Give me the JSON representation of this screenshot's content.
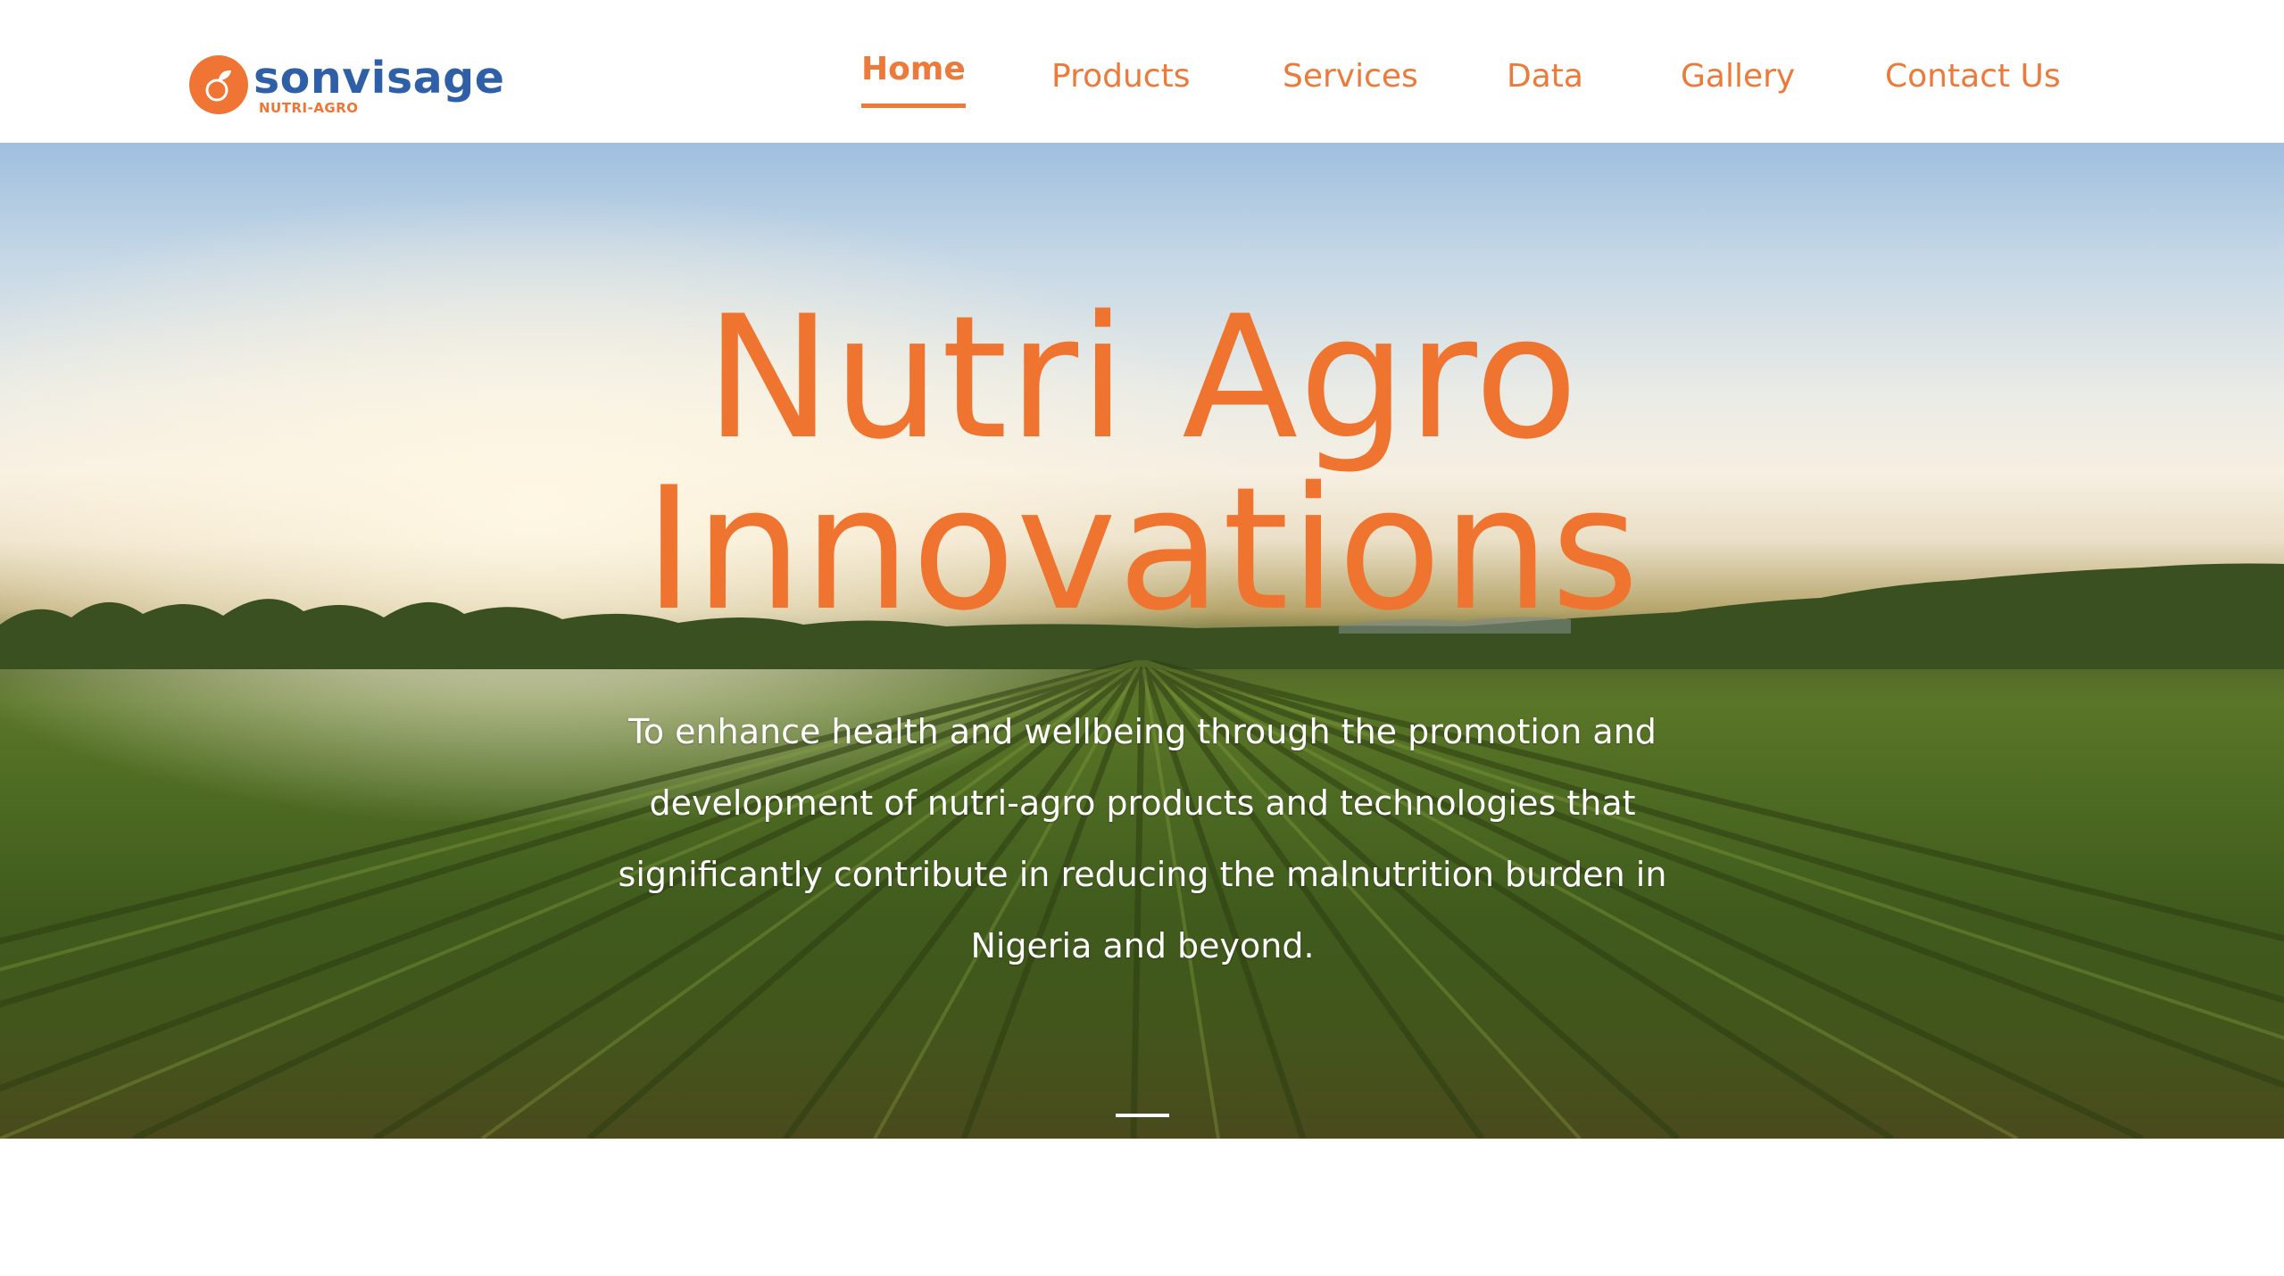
{
  "brand": {
    "name": "sonvisage",
    "tagline": "NUTRI-AGRO",
    "colors": {
      "orange": "#f07535",
      "blue": "#2f5fa6"
    }
  },
  "nav": {
    "items": [
      {
        "label": "Home",
        "active": true
      },
      {
        "label": "Products",
        "active": false
      },
      {
        "label": "Services",
        "active": false
      },
      {
        "label": "Data",
        "active": false
      },
      {
        "label": "Gallery",
        "active": false
      },
      {
        "label": "Contact Us",
        "active": false
      }
    ]
  },
  "hero": {
    "title_line1": "Nutri Agro",
    "title_line2": "Innovations",
    "description": "To enhance health and wellbeing through the promotion and development of nutri-agro products and technologies that significantly contribute in reducing the malnutrition burden in Nigeria and beyond.",
    "background": "farm-field-sunset-image",
    "slide_current": 1
  }
}
